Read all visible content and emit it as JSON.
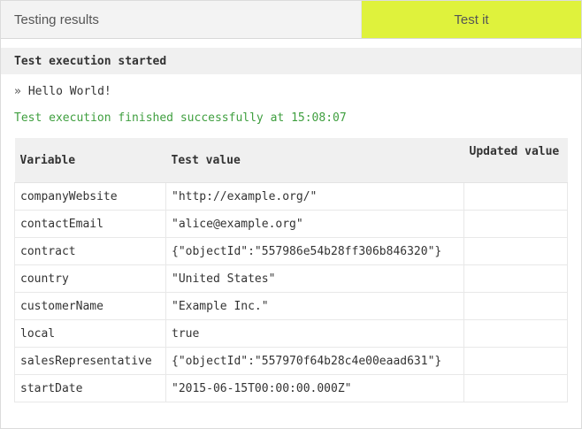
{
  "header": {
    "title": "Testing results",
    "test_button_label": "Test it"
  },
  "section": {
    "title": "Test execution started"
  },
  "output": {
    "bullet": "»",
    "message": "Hello World!",
    "status": "Test execution finished successfully at 15:08:07"
  },
  "table": {
    "columns": [
      "Variable",
      "Test value",
      "Updated value"
    ],
    "rows": [
      {
        "variable": "companyWebsite",
        "test_value": "\"http://example.org/\"",
        "updated_value": ""
      },
      {
        "variable": "contactEmail",
        "test_value": "\"alice@example.org\"",
        "updated_value": ""
      },
      {
        "variable": "contract",
        "test_value": "{\"objectId\":\"557986e54b28ff306b846320\"}",
        "updated_value": ""
      },
      {
        "variable": "country",
        "test_value": "\"United States\"",
        "updated_value": ""
      },
      {
        "variable": "customerName",
        "test_value": "\"Example Inc.\"",
        "updated_value": ""
      },
      {
        "variable": "local",
        "test_value": "true",
        "updated_value": ""
      },
      {
        "variable": "salesRepresentative",
        "test_value": "{\"objectId\":\"557970f64b28c4e00eaad631\"}",
        "updated_value": ""
      },
      {
        "variable": "startDate",
        "test_value": "\"2015-06-15T00:00:00.000Z\"",
        "updated_value": ""
      }
    ]
  },
  "colors": {
    "accent": "#dff23c",
    "success": "#3f9f3f"
  }
}
